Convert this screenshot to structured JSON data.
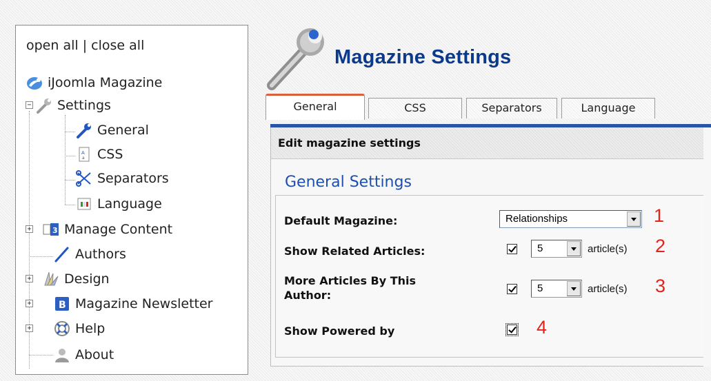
{
  "tree": {
    "open_all": "open all",
    "separator": "|",
    "close_all": "close all",
    "items": [
      {
        "label": "iJoomla Magazine",
        "icon": "magazine-logo-icon"
      },
      {
        "label": "Settings",
        "icon": "wrench-icon",
        "expanded": true
      },
      {
        "label": "General",
        "icon": "blue-wrench-icon"
      },
      {
        "label": "CSS",
        "icon": "css-file-icon"
      },
      {
        "label": "Separators",
        "icon": "scissors-icon"
      },
      {
        "label": "Language",
        "icon": "flag-icon"
      },
      {
        "label": "Manage Content",
        "icon": "content-icon",
        "expanded": false
      },
      {
        "label": "Authors",
        "icon": "pen-icon"
      },
      {
        "label": "Design",
        "icon": "design-icon",
        "expanded": false
      },
      {
        "label": "Magazine Newsletter",
        "icon": "newsletter-icon",
        "expanded": false
      },
      {
        "label": "Help",
        "icon": "help-lifebuoy-icon",
        "expanded": false
      },
      {
        "label": "About",
        "icon": "user-icon"
      }
    ]
  },
  "header": {
    "title": "Magazine Settings",
    "icon": "wrench-large-icon"
  },
  "tabs": [
    {
      "label": "General",
      "active": true
    },
    {
      "label": "CSS",
      "active": false
    },
    {
      "label": "Separators",
      "active": false
    },
    {
      "label": "Language",
      "active": false
    }
  ],
  "panel": {
    "header": "Edit magazine settings",
    "section_title": "General Settings",
    "fields": {
      "default_magazine": {
        "label": "Default Magazine:",
        "value": "Relationships",
        "marker": "1"
      },
      "related_articles": {
        "label": "Show Related Articles:",
        "checked": true,
        "value": "5",
        "unit": "article(s)",
        "marker": "2"
      },
      "more_by_author": {
        "label_line1": "More Articles By This",
        "label_line2": "Author:",
        "checked": true,
        "value": "5",
        "unit": "article(s)",
        "marker": "3"
      },
      "powered_by": {
        "label": "Show Powered by",
        "checked": true,
        "marker": "4"
      }
    }
  },
  "colors": {
    "title_blue": "#0b3a8c",
    "heading_blue": "#1d4fae",
    "tab_accent": "#d9603a",
    "marker_red": "#e5231b"
  }
}
